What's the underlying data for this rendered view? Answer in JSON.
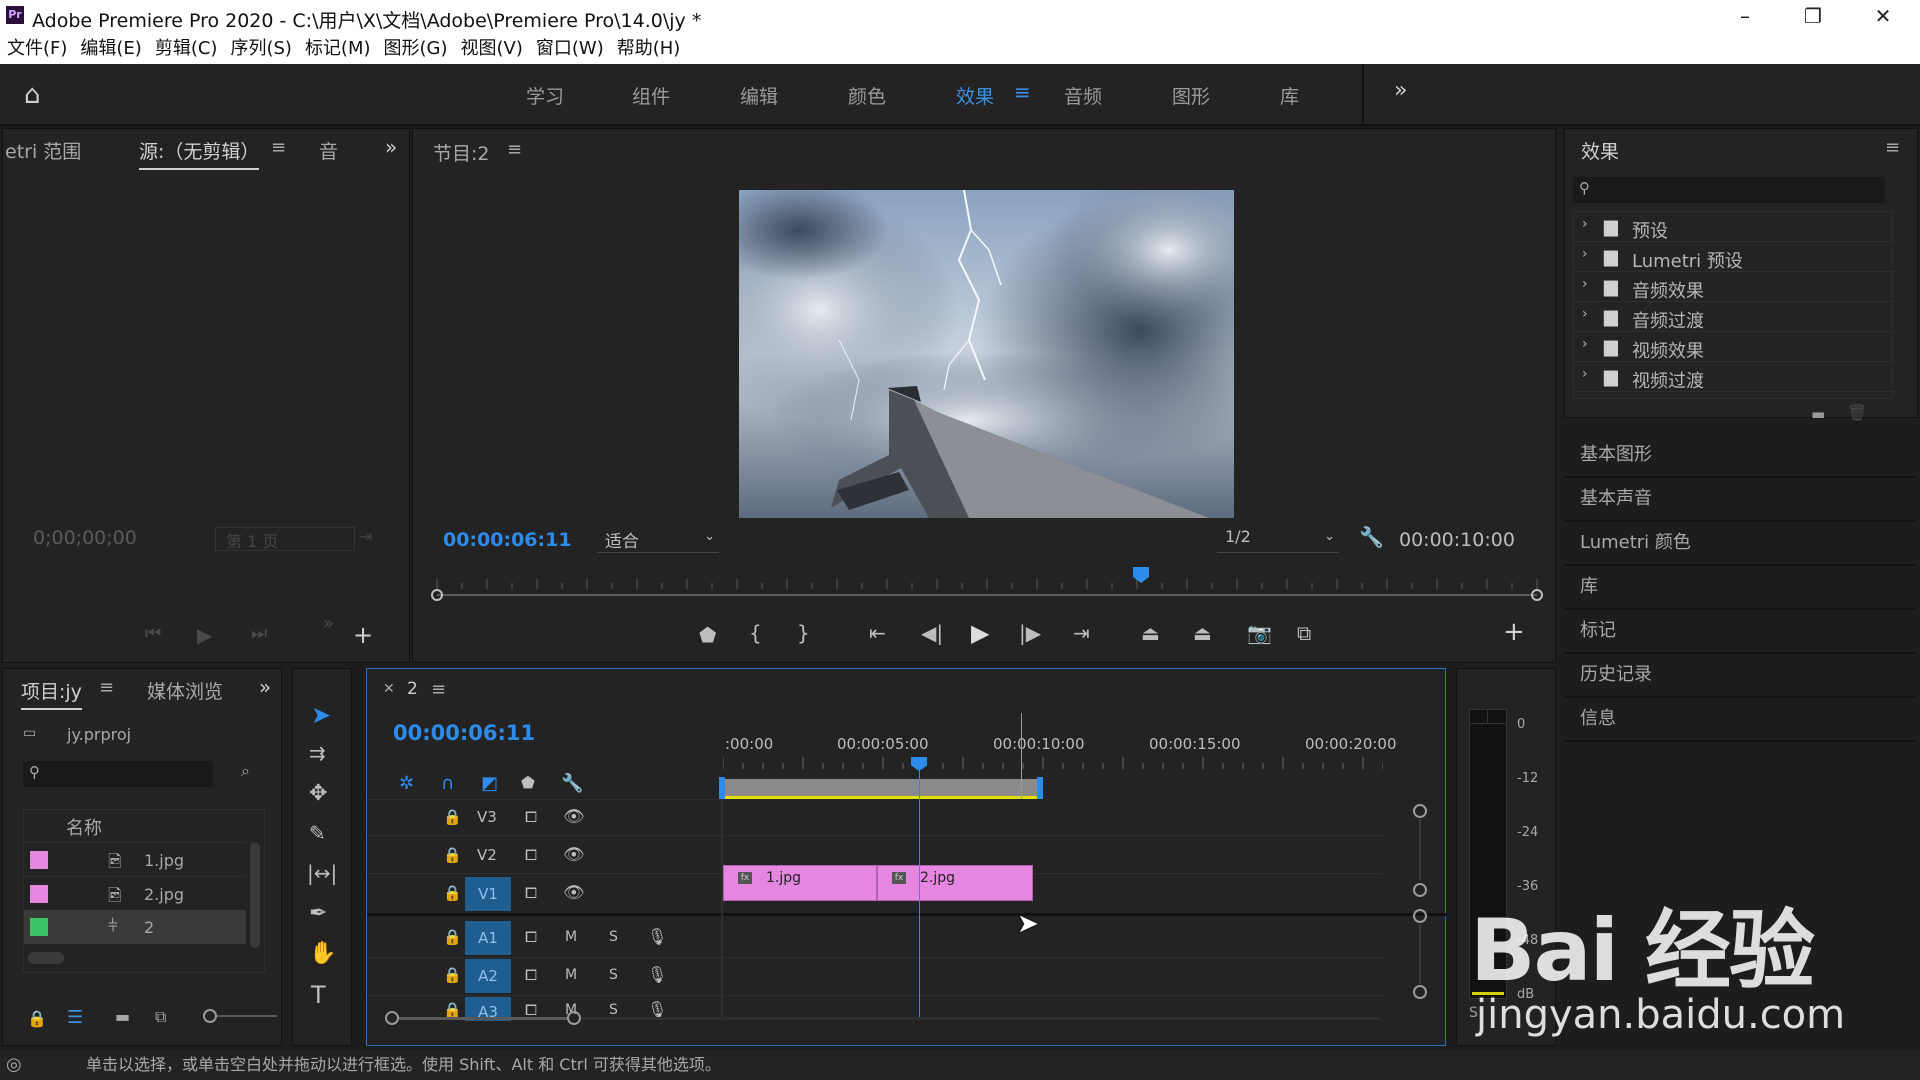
{
  "window": {
    "title": "Adobe Premiere Pro 2020 - C:\\用户\\X\\文档\\Adobe\\Premiere Pro\\14.0\\jy *",
    "logo": "Pr"
  },
  "menu": [
    "文件(F)",
    "编辑(E)",
    "剪辑(C)",
    "序列(S)",
    "标记(M)",
    "图形(G)",
    "视图(V)",
    "窗口(W)",
    "帮助(H)"
  ],
  "workspaces": [
    "学习",
    "组件",
    "编辑",
    "颜色",
    "效果",
    "音频",
    "图形",
    "库"
  ],
  "active_workspace": "效果",
  "source_panel": {
    "tabs": [
      "etri 范围",
      "源:（无剪辑）",
      "音"
    ],
    "timecode": "0;00;00;00",
    "page": "第 1 页"
  },
  "program_panel": {
    "title": "节目:2",
    "timecode_current": "00:00:06:11",
    "fit": "适合",
    "resolution": "1/2",
    "timecode_duration": "00:00:10:00",
    "playhead_fraction": 0.64
  },
  "effects_panel": {
    "title": "效果",
    "items": [
      "预设",
      "Lumetri 预设",
      "音频效果",
      "音频过渡",
      "视频效果",
      "视频过渡"
    ]
  },
  "side_panels": [
    "基本图形",
    "基本声音",
    "Lumetri 颜色",
    "库",
    "标记",
    "历史记录",
    "信息"
  ],
  "project_panel": {
    "tabs": [
      "项目:jy",
      "媒体浏览"
    ],
    "file": "jy.prproj",
    "column": "名称",
    "items": [
      {
        "name": "1.jpg",
        "color": "#e586e0"
      },
      {
        "name": "2.jpg",
        "color": "#e586e0"
      },
      {
        "name": "2",
        "color": "#3ec468"
      }
    ]
  },
  "timeline": {
    "tab": "2",
    "timecode": "00:00:06:11",
    "ruler": [
      ":00:00",
      "00:00:05:00",
      "00:00:10:00",
      "00:00:15:00",
      "00:00:20:00"
    ],
    "video_tracks": [
      "V3",
      "V2",
      "V1"
    ],
    "audio_tracks": [
      "A1",
      "A2",
      "A3"
    ],
    "clips": [
      "1.jpg",
      "2.jpg"
    ],
    "mute": "M",
    "solo": "S"
  },
  "meter": {
    "labels": [
      "0",
      "-12",
      "-24",
      "-36",
      "-48",
      "dB"
    ]
  },
  "status_bar": "单击以选择，或单击空白处并拖动以进行框选。使用 Shift、Alt 和 Ctrl 可获得其他选项。",
  "watermark": {
    "brand": "Bai 经验",
    "url": "jingyan.baidu.com"
  },
  "colors": {
    "accent": "#2d8ceb",
    "clip": "#e586e0",
    "track_target": "#1f5e8f"
  }
}
